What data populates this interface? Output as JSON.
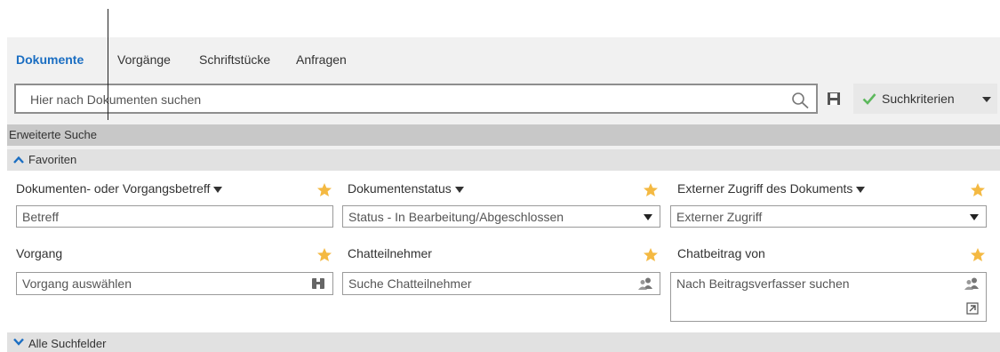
{
  "tabs": [
    {
      "label": "Dokumente",
      "active": true
    },
    {
      "label": "Vorgänge",
      "active": false
    },
    {
      "label": "Schriftstücke",
      "active": false
    },
    {
      "label": "Anfragen",
      "active": false
    }
  ],
  "search": {
    "placeholder": "Hier nach Dokumenten suchen",
    "criteria_label": "Suchkriterien"
  },
  "advanced": {
    "label": "Erweiterte Suche"
  },
  "favorites": {
    "label": "Favoriten"
  },
  "all_fields": {
    "label": "Alle Suchfelder"
  },
  "fields": {
    "betreff": {
      "label": "Dokumenten- oder Vorgangsbetreff",
      "value": "Betreff"
    },
    "status": {
      "label": "Dokumentenstatus",
      "value": "Status - In Bearbeitung/Abgeschlossen"
    },
    "extern": {
      "label": "Externer Zugriff des Dokuments",
      "value": "Externer Zugriff"
    },
    "vorgang": {
      "label": "Vorgang",
      "placeholder": "Vorgang auswählen"
    },
    "chatteilnehmer": {
      "label": "Chatteilnehmer",
      "placeholder": "Suche Chatteilnehmer"
    },
    "chatbeitrag": {
      "label": "Chatbeitrag von",
      "placeholder": "Nach Beitragsverfasser suchen"
    }
  },
  "colors": {
    "accent": "#1b6ec2",
    "star": "#f4b942",
    "check": "#5cb85c"
  }
}
